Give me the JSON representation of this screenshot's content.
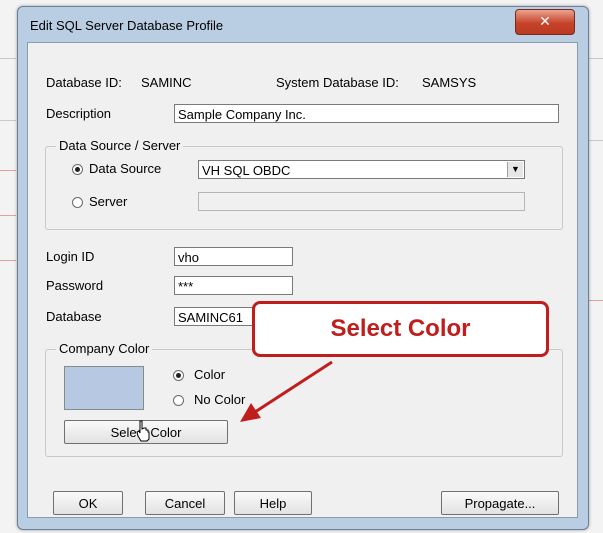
{
  "window": {
    "title": "Edit SQL Server Database Profile",
    "close_glyph": "✕"
  },
  "fields": {
    "database_id_label": "Database ID:",
    "database_id_value": "SAMINC",
    "system_database_id_label": "System Database ID:",
    "system_database_id_value": "SAMSYS",
    "description_label": "Description",
    "description_value": "Sample Company Inc.",
    "login_id_label": "Login ID",
    "login_id_value": "vho",
    "password_label": "Password",
    "password_value": "***",
    "database_label": "Database",
    "database_value": "SAMINC61"
  },
  "data_source_group": {
    "title": "Data Source / Server",
    "data_source_label": "Data Source",
    "data_source_value": "VH SQL OBDC",
    "data_source_selected": true,
    "server_label": "Server",
    "server_value": ""
  },
  "company_color_group": {
    "title": "Company Color",
    "color_option": "Color",
    "no_color_option": "No Color",
    "selected": "Color",
    "swatch_color": "#b7c9e2",
    "select_color_button": "Select Color"
  },
  "buttons": {
    "ok": "OK",
    "cancel": "Cancel",
    "help": "Help",
    "propagate": "Propagate..."
  },
  "annotation": {
    "callout_text": "Select Color",
    "callout_color": "#c01d1d"
  }
}
